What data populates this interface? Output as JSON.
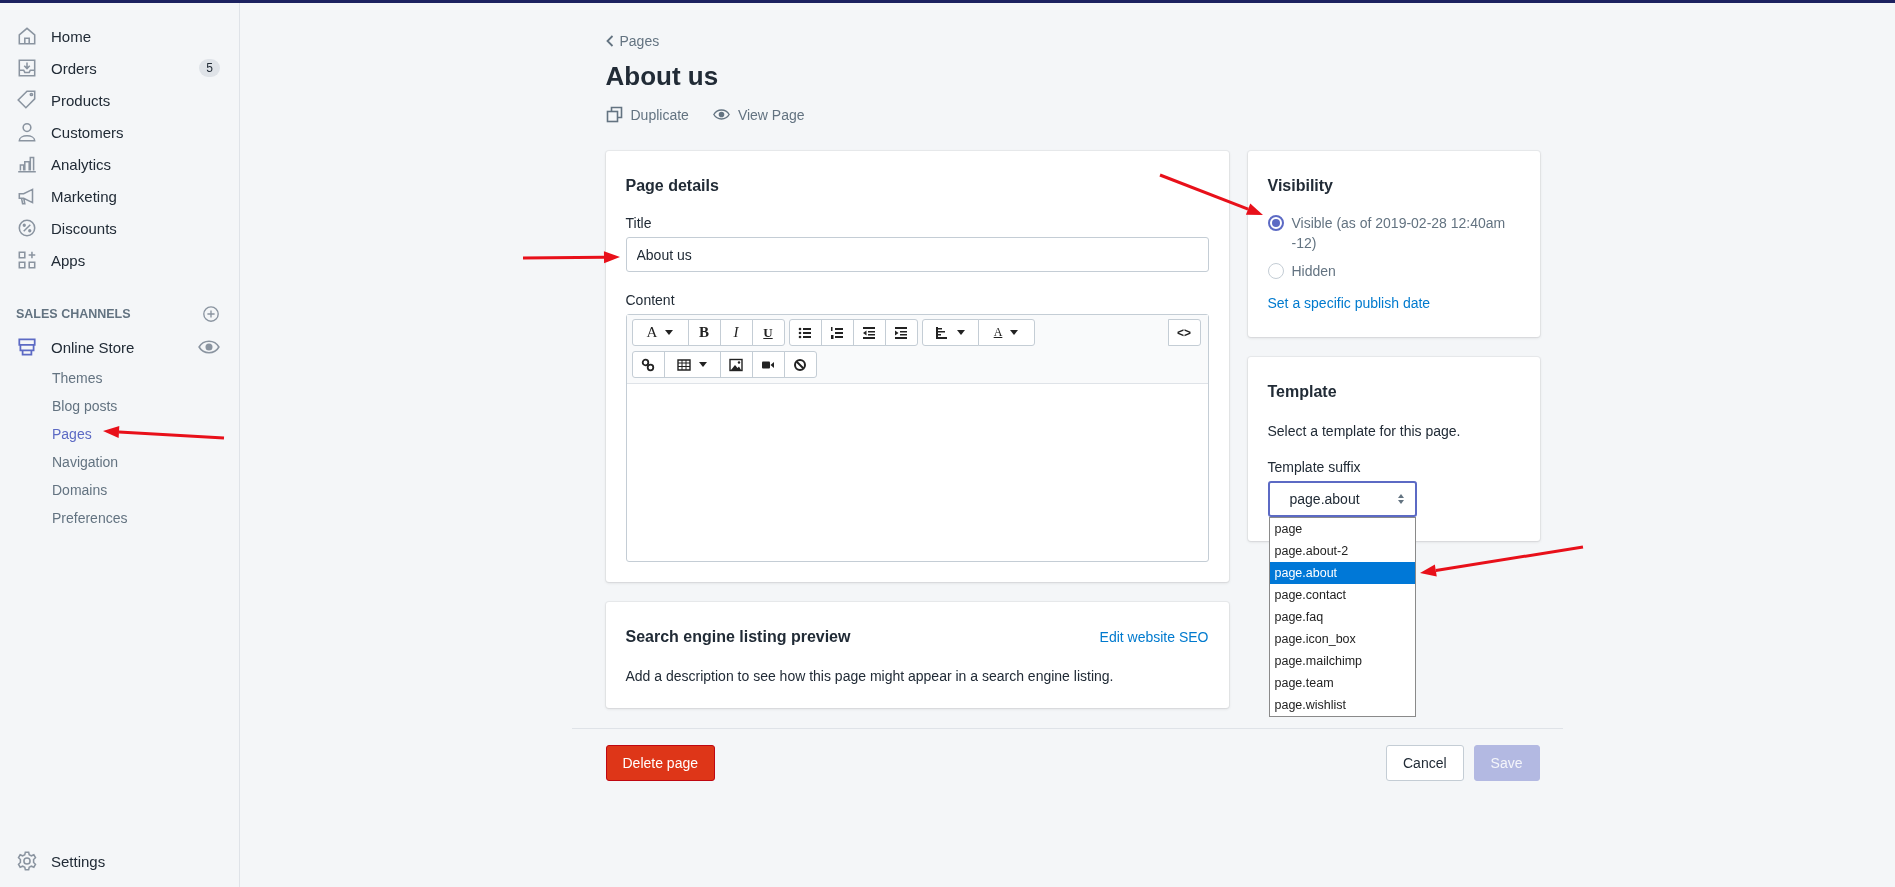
{
  "sidebar": {
    "items": [
      {
        "label": "Home",
        "selected": false
      },
      {
        "label": "Orders",
        "badge": "5",
        "selected": false
      },
      {
        "label": "Products",
        "selected": false
      },
      {
        "label": "Customers",
        "selected": false
      },
      {
        "label": "Analytics",
        "selected": false
      },
      {
        "label": "Marketing",
        "selected": false
      },
      {
        "label": "Discounts",
        "selected": false
      },
      {
        "label": "Apps",
        "selected": false
      }
    ],
    "sales_channels": {
      "heading": "SALES CHANNELS",
      "channel": {
        "label": "Online Store",
        "selected": true
      },
      "subitems": [
        {
          "label": "Themes",
          "selected": false
        },
        {
          "label": "Blog posts",
          "selected": false
        },
        {
          "label": "Pages",
          "selected": true
        },
        {
          "label": "Navigation",
          "selected": false
        },
        {
          "label": "Domains",
          "selected": false
        },
        {
          "label": "Preferences",
          "selected": false
        }
      ]
    },
    "settings": {
      "label": "Settings"
    }
  },
  "breadcrumb": "Pages",
  "title": "About us",
  "actions": [
    {
      "label": "Duplicate"
    },
    {
      "label": "View Page"
    }
  ],
  "page_details": {
    "heading": "Page details",
    "title_label": "Title",
    "title_value": "About us",
    "content_label": "Content",
    "toolbar": [
      {
        "groups": [
          [
            {
              "kind": "font",
              "label": "A"
            },
            {
              "kind": "bold",
              "label": "B"
            },
            {
              "kind": "italic",
              "label": "I"
            },
            {
              "kind": "underline",
              "label": "U"
            }
          ],
          [
            {
              "kind": "bullets"
            },
            {
              "kind": "numbers"
            },
            {
              "kind": "outdent"
            },
            {
              "kind": "indent"
            }
          ],
          [
            {
              "kind": "align"
            },
            {
              "kind": "color",
              "label": "A"
            }
          ]
        ],
        "end": [
          {
            "kind": "code",
            "label": "<>"
          }
        ]
      },
      {
        "groups": [
          [
            {
              "kind": "link"
            },
            {
              "kind": "table"
            },
            {
              "kind": "image"
            },
            {
              "kind": "video"
            },
            {
              "kind": "clear"
            }
          ]
        ]
      }
    ]
  },
  "seo": {
    "heading": "Search engine listing preview",
    "link": "Edit website SEO",
    "text": "Add a description to see how this page might appear in a search engine listing."
  },
  "visibility": {
    "heading": "Visibility",
    "options": [
      {
        "label": "Visible (as of 2019-02-28 12:40am -12)",
        "selected": true
      },
      {
        "label": "Hidden",
        "selected": false
      }
    ],
    "link": "Set a specific publish date"
  },
  "template": {
    "heading": "Template",
    "description": "Select a template for this page.",
    "label": "Template suffix",
    "value": "page.about",
    "expanded": true,
    "options": [
      {
        "label": "page",
        "selected": false
      },
      {
        "label": "page.about-2",
        "selected": false
      },
      {
        "label": "page.about",
        "selected": true
      },
      {
        "label": "page.contact",
        "selected": false
      },
      {
        "label": "page.faq",
        "selected": false
      },
      {
        "label": "page.icon_box",
        "selected": false
      },
      {
        "label": "page.mailchimp",
        "selected": false
      },
      {
        "label": "page.team",
        "selected": false
      },
      {
        "label": "page.wishlist",
        "selected": false
      }
    ]
  },
  "footer": {
    "delete": "Delete page",
    "cancel": "Cancel",
    "save": {
      "label": "Save",
      "disabled": true
    }
  }
}
